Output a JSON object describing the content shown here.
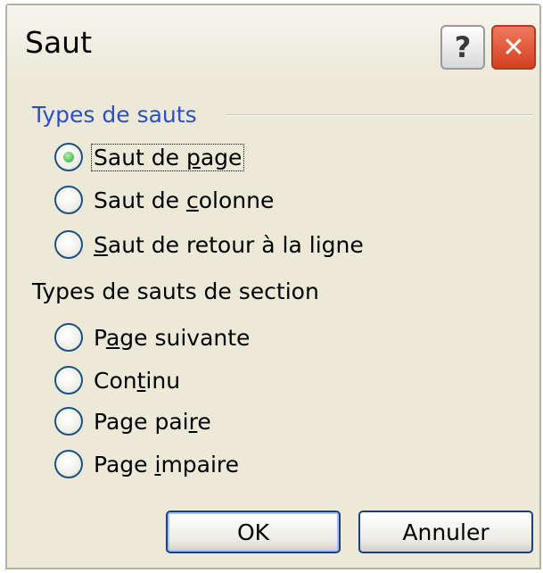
{
  "window": {
    "title": "Saut",
    "help_label": "?",
    "close_label": "✕"
  },
  "break_types": {
    "label": "Types de sauts",
    "options": [
      {
        "pre": "Saut de ",
        "key": "p",
        "post": "age",
        "selected": true
      },
      {
        "pre": "Saut de ",
        "key": "c",
        "post": "olonne",
        "selected": false
      },
      {
        "pre": "",
        "key": "S",
        "post": "aut de retour à la ligne",
        "selected": false
      }
    ]
  },
  "section_break_types": {
    "label": "Types de sauts de section",
    "options": [
      {
        "pre": "P",
        "key": "a",
        "post": "ge suivante",
        "selected": false
      },
      {
        "pre": "Con",
        "key": "t",
        "post": "inu",
        "selected": false
      },
      {
        "pre": "Page pai",
        "key": "r",
        "post": "e",
        "selected": false
      },
      {
        "pre": "Page ",
        "key": "i",
        "post": "mpaire",
        "selected": false
      }
    ]
  },
  "buttons": {
    "ok_label": "OK",
    "cancel_label": "Annuler"
  },
  "colors": {
    "group_label_accent": "#2d4fc4",
    "dialog_background": "#ece9d8",
    "selected_radio": "#27a53b"
  }
}
